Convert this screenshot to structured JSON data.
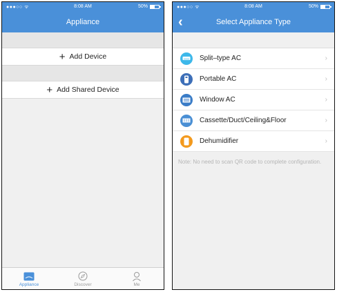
{
  "left": {
    "status": {
      "signal": "●●●○○ ᯤ",
      "time": "8:08 AM",
      "battery": "50%",
      "battery_level": 0.5
    },
    "title": "Appliance",
    "add_device": "Add Device",
    "add_shared_device": "Add Shared Device",
    "tabs": [
      {
        "label": "Appliance",
        "icon": "appliance-icon",
        "active": true
      },
      {
        "label": "Discover",
        "icon": "compass-icon",
        "active": false
      },
      {
        "label": "Me",
        "icon": "person-icon",
        "active": false
      }
    ]
  },
  "right": {
    "status": {
      "signal": "●●●○○ ᯤ",
      "time": "8:08 AM",
      "battery": "50%",
      "battery_level": 0.5
    },
    "title": "Select Appliance Type",
    "items": [
      {
        "label": "Split–type AC",
        "icon": "split-ac-icon",
        "color": "#3db8ea"
      },
      {
        "label": "Portable AC",
        "icon": "portable-ac-icon",
        "color": "#3d6fb8"
      },
      {
        "label": "Window AC",
        "icon": "window-ac-icon",
        "color": "#3a7cc7"
      },
      {
        "label": "Cassette/Duct/Ceiling&Floor",
        "icon": "cassette-ac-icon",
        "color": "#4a8fd4"
      },
      {
        "label": "Dehumidifier",
        "icon": "dehumidifier-icon",
        "color": "#f39a1e"
      }
    ],
    "note": "Note: No need to scan QR code to complete configuration."
  },
  "colors": {
    "accent": "#4a90d9",
    "background": "#f0f0f0"
  }
}
